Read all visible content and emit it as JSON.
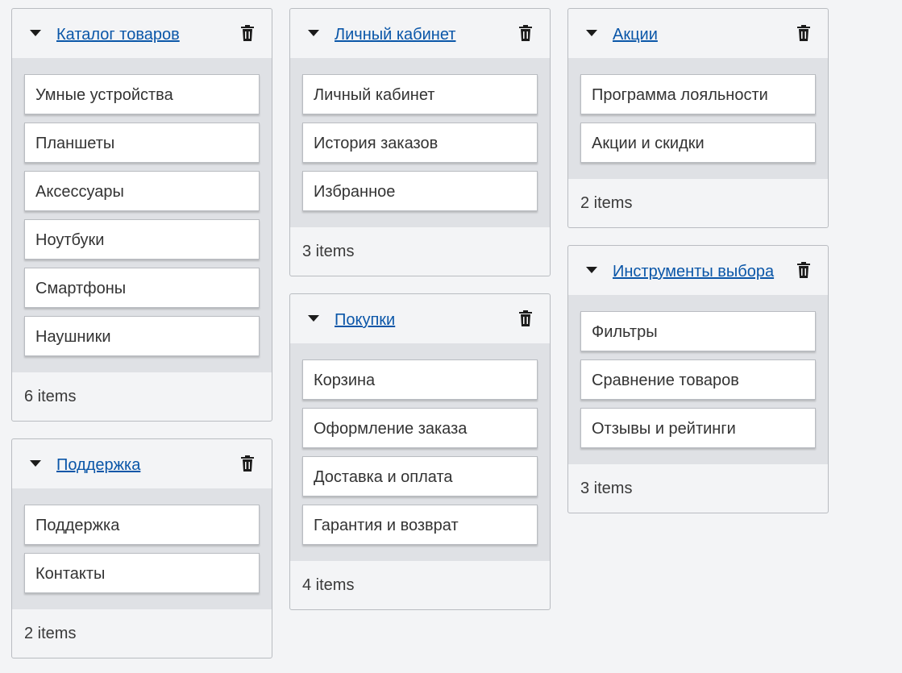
{
  "columns": [
    {
      "cards": [
        {
          "title": "Каталог товаров",
          "items": [
            "Умные устройства",
            "Планшеты",
            "Аксессуары",
            "Ноутбуки",
            "Смартфоны",
            "Наушники"
          ],
          "count_label": "6 items"
        },
        {
          "title": "Поддержка",
          "items": [
            "Поддержка",
            "Контакты"
          ],
          "count_label": "2 items"
        }
      ]
    },
    {
      "cards": [
        {
          "title": "Личный кабинет",
          "items": [
            "Личный кабинет",
            "История заказов",
            "Избранное"
          ],
          "count_label": "3 items"
        },
        {
          "title": "Покупки",
          "items": [
            "Корзина",
            "Оформление заказа",
            "Доставка и оплата",
            "Гарантия и возврат"
          ],
          "count_label": "4 items"
        }
      ]
    },
    {
      "cards": [
        {
          "title": "Акции",
          "items": [
            "Программа лояльности",
            "Акции и скидки"
          ],
          "count_label": "2 items"
        },
        {
          "title": "Инструменты выбора",
          "items": [
            "Фильтры",
            "Сравнение товаров",
            "Отзывы и рейтинги"
          ],
          "count_label": "3 items"
        }
      ]
    }
  ],
  "icons": {
    "toggle": "caret-down-icon",
    "delete": "trash-icon"
  },
  "colors": {
    "link": "#0a56a8",
    "page_bg": "#f3f4f6",
    "body_bg": "#dfe1e5",
    "border": "#b9bcc1"
  }
}
